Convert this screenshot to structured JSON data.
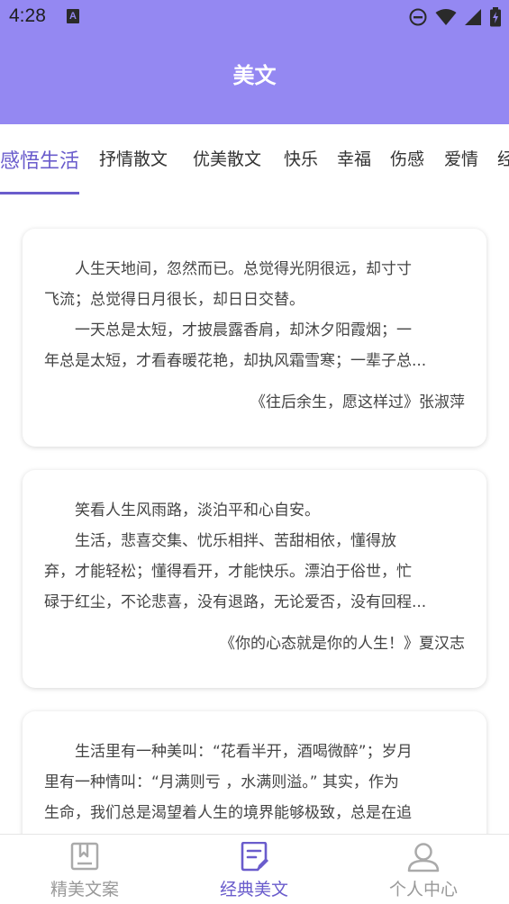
{
  "status_bar": {
    "time": "4:28",
    "notification_icon_letter": "A"
  },
  "header": {
    "title": "美文",
    "background_color": "#9488f2"
  },
  "tabs": [
    {
      "label": "感悟生活",
      "active": true
    },
    {
      "label": "抒情散文",
      "active": false
    },
    {
      "label": "优美散文",
      "active": false
    },
    {
      "label": "快乐",
      "active": false
    },
    {
      "label": "幸福",
      "active": false
    },
    {
      "label": "伤感",
      "active": false
    },
    {
      "label": "爱情",
      "active": false
    },
    {
      "label": "经",
      "active": false
    }
  ],
  "accent_color": "#6a5ccc",
  "cards": [
    {
      "lines": [
        "人生天地间，忽然而已。总觉得光阴很远，却寸寸",
        "飞流；总觉得日月很长，却日日交替。",
        "一天总是太短，才披晨露香肩，却沐夕阳霞烟；一",
        "年总是太短，才看春暖花艳，却执风霜雪寒；一辈子总..."
      ],
      "source": "《往后余生，愿这样过》张淑萍"
    },
    {
      "lines": [
        "笑看人生风雨路，淡泊平和心自安。",
        "生活，悲喜交集、忧乐相拌、苦甜相依，懂得放",
        "弃，才能轻松；懂得看开，才能快乐。漂泊于俗世，忙",
        "碌于红尘，不论悲喜，没有退路，无论爱否，没有回程..."
      ],
      "source": "《你的心态就是你的人生！》夏汉志"
    },
    {
      "lines": [
        "生活里有一种美叫：“花看半开，酒喝微醉”；岁月",
        "里有一种情叫：“月满则亏 ，水满则溢。” 其实，作为",
        "生命，我们总是渴望着人生的境界能够极致，总是在追"
      ],
      "source": ""
    }
  ],
  "bottom_nav": [
    {
      "label": "精美文案",
      "icon": "bookmark-book-icon",
      "active": false
    },
    {
      "label": "经典美文",
      "icon": "article-edit-icon",
      "active": true
    },
    {
      "label": "个人中心",
      "icon": "person-icon",
      "active": false
    }
  ]
}
